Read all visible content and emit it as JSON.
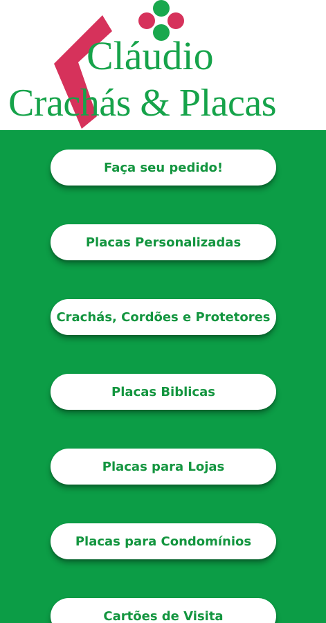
{
  "brand": {
    "name_line1": "Cláudio",
    "name_line2": "Crachás & Placas",
    "primary_color": "#0c9d46",
    "accent_red": "#d6325b",
    "accent_green": "#19a84d"
  },
  "menu": {
    "items": [
      {
        "label": "Faça seu pedido!"
      },
      {
        "label": "Placas Personalizadas"
      },
      {
        "label": "Crachás, Cordões e Protetores"
      },
      {
        "label": "Placas Biblicas"
      },
      {
        "label": "Placas para Lojas"
      },
      {
        "label": "Placas para Condomínios"
      },
      {
        "label": "Cartões de Visita"
      }
    ]
  }
}
